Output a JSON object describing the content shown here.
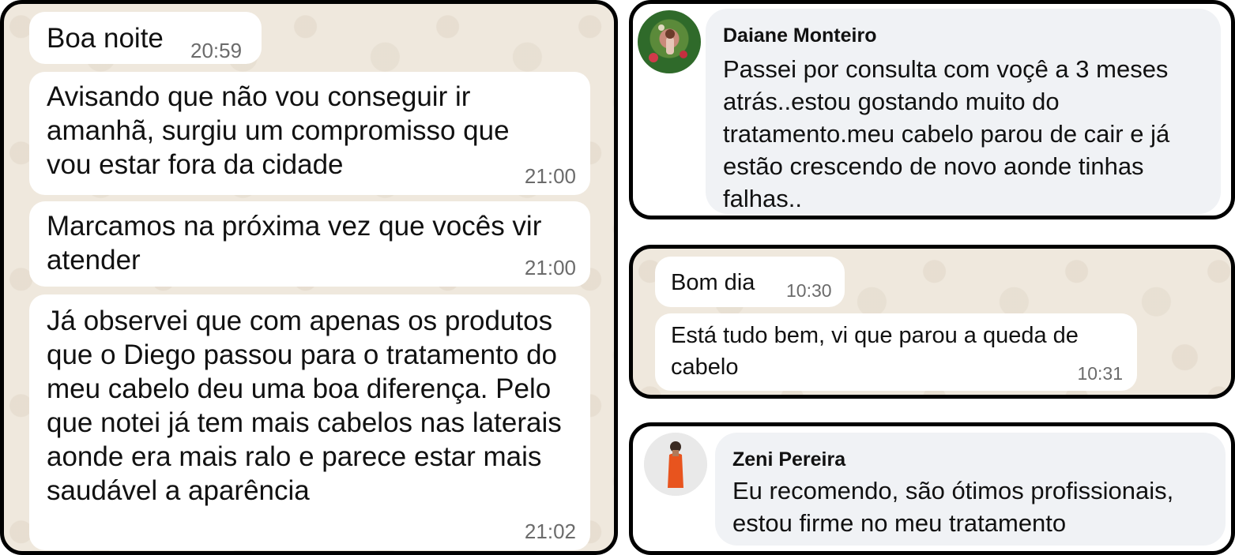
{
  "left_chat": {
    "messages": [
      {
        "text": "Boa noite",
        "time": "20:59"
      },
      {
        "text": "Avisando que não vou conseguir ir amanhã, surgiu um compromisso que vou estar fora da cidade",
        "time": "21:00"
      },
      {
        "text": "Marcamos na próxima vez que vocês vir atender",
        "time": "21:00"
      },
      {
        "text": "Já observei que com apenas os produtos que o Diego passou para o tratamento do meu cabelo deu uma boa diferença. Pelo que notei já tem mais cabelos nas laterais aonde era mais ralo e parece estar mais saudável a aparência",
        "time": "21:02"
      }
    ]
  },
  "comment_daiane": {
    "name": "Daiane Monteiro",
    "text": "Passei por consulta com voçê a 3 meses atrás..estou gostando muito do tratamento.meu cabelo parou de cair e já estão crescendo de novo aonde tinhas falhas..",
    "avatar_icon": "profile-photo-flowers"
  },
  "mid_chat": {
    "messages": [
      {
        "text": "Bom dia",
        "time": "10:30"
      },
      {
        "text": "Está tudo bem, vi que parou a queda de cabelo",
        "time": "10:31"
      }
    ]
  },
  "comment_zeni": {
    "name": "Zeni Pereira",
    "text": "Eu recomendo, são ótimos profissionais, estou firme no meu tratamento",
    "avatar_icon": "profile-photo-woman-orange-dress"
  },
  "colors": {
    "whatsapp_background": "#efe8dd",
    "bubble": "#ffffff",
    "facebook_bubble": "#f0f2f5",
    "timestamp": "#6b6b6b",
    "frame": "#000000"
  }
}
